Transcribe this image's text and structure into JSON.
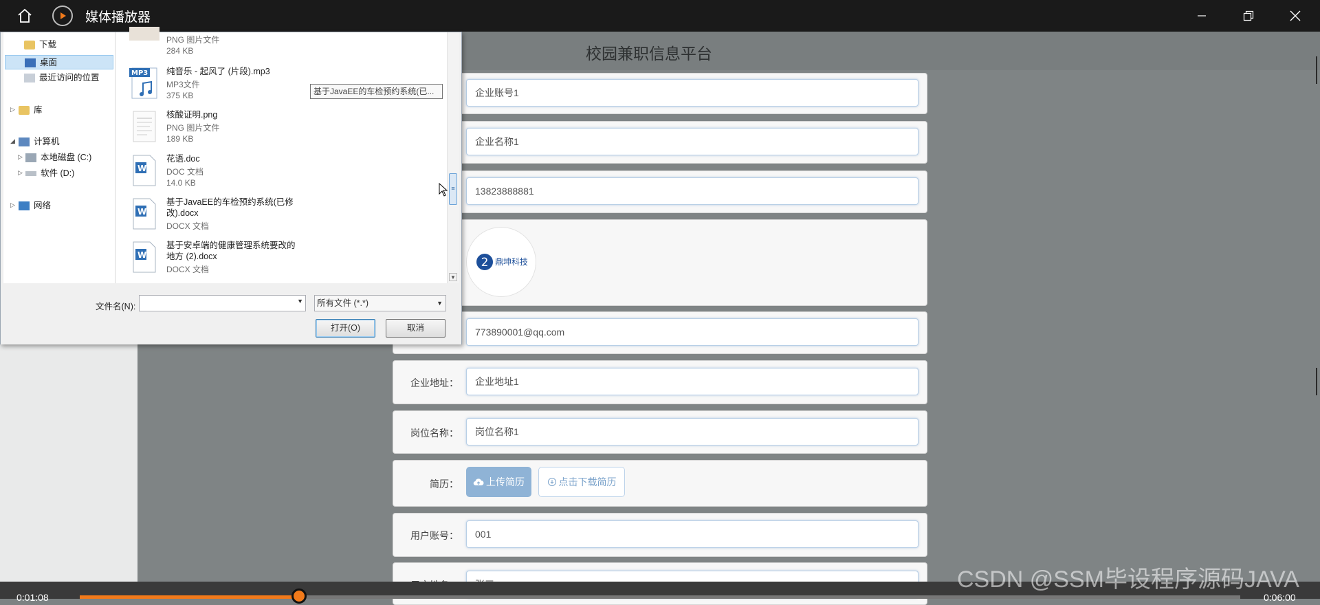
{
  "player": {
    "title": "媒体播放器",
    "current_time": "0:01:08",
    "total_time": "0:06:00",
    "progress": 0.189
  },
  "page": {
    "title": "校园兼职信息平台",
    "fields": {
      "company_account": "企业账号1",
      "company_name": "企业名称1",
      "phone": "13823888881",
      "email": "773890001@qq.com",
      "address_label": "企业地址：",
      "address": "企业地址1",
      "position_label": "岗位名称：",
      "position": "岗位名称1",
      "resume_label": "简历：",
      "upload_resume": "上传简历",
      "download_resume": "点击下载简历",
      "user_account_label": "用户账号：",
      "user_account": "001",
      "user_name_label": "用户姓名：",
      "user_name": "张三"
    },
    "logo_text": "鼎坤科技"
  },
  "dialog": {
    "nav": [
      {
        "label": "下载"
      },
      {
        "label": "桌面"
      },
      {
        "label": "最近访问的位置"
      },
      {
        "label": "库"
      },
      {
        "label": "计算机"
      },
      {
        "label": "本地磁盘 (C:)"
      },
      {
        "label": "软件 (D:)"
      },
      {
        "label": "网络"
      }
    ],
    "files": [
      {
        "name": "",
        "type": "PNG 图片文件",
        "size": "284 KB"
      },
      {
        "name": "纯音乐 - 起风了 (片段).mp3",
        "type": "MP3文件",
        "size": "375 KB"
      },
      {
        "name": "核酸证明.png",
        "type": "PNG 图片文件",
        "size": "189 KB"
      },
      {
        "name": "花语.doc",
        "type": "DOC 文档",
        "size": "14.0 KB"
      },
      {
        "name": "基于JavaEE的车检预约系统(已修",
        "name2": "改).docx",
        "type": "DOCX 文档"
      },
      {
        "name": "基于安卓端的健康管理系统要改的",
        "name2": "地方 (2).docx",
        "type": "DOCX 文档"
      }
    ],
    "tooltip": "基于JavaEE的车检预约系统(已...",
    "filename_label": "文件名(N):",
    "filename_value": "",
    "filetype": "所有文件 (*.*)",
    "open_button": "打开(O)",
    "cancel_button": "取消",
    "mp3_badge": "MP3"
  },
  "watermark": "CSDN @SSM毕设程序源码JAVA"
}
